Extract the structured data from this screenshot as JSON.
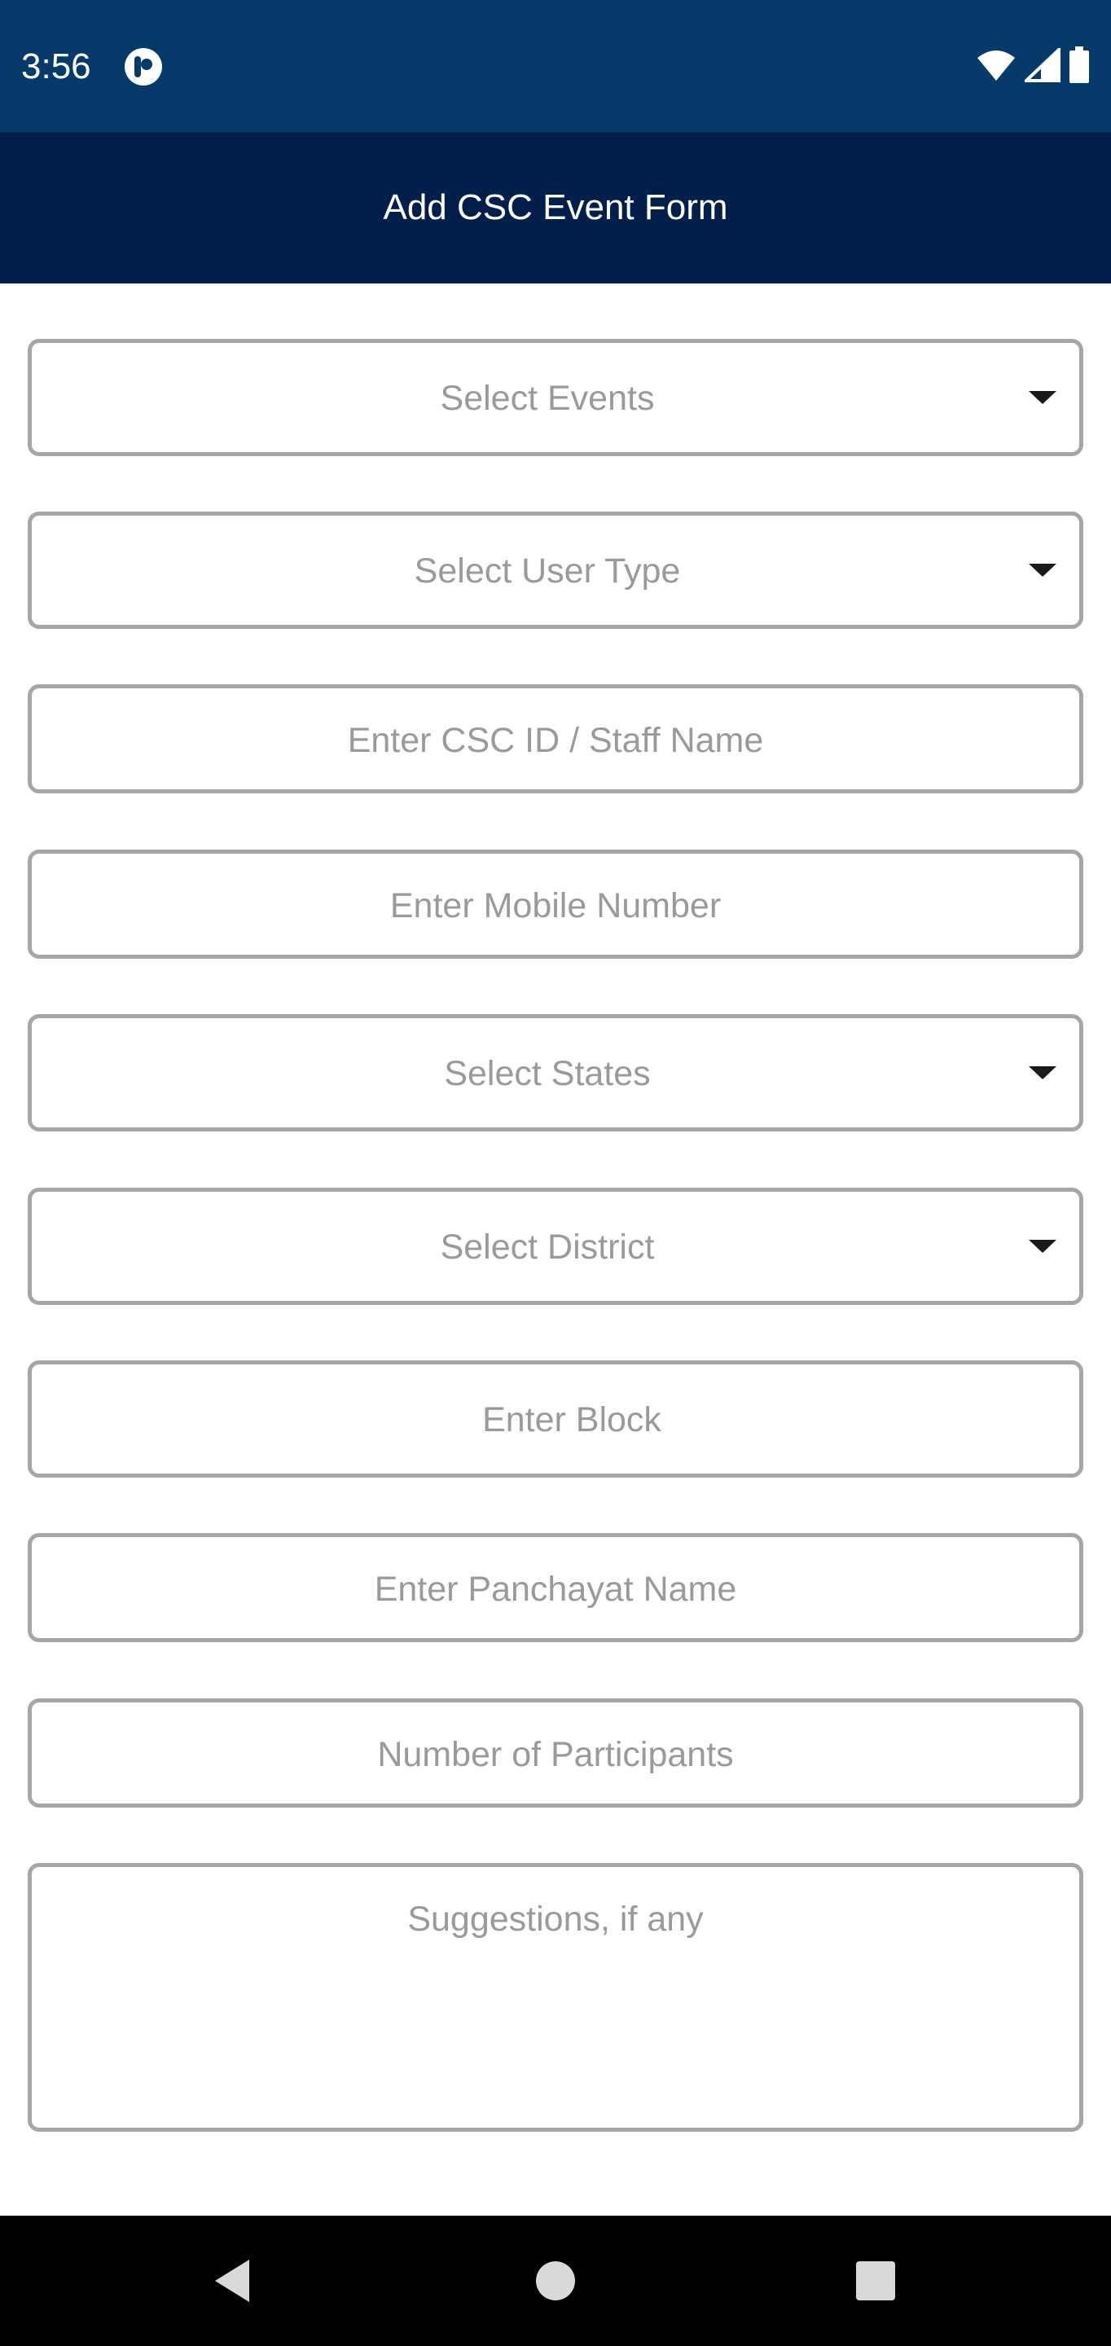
{
  "status_bar": {
    "time": "3:56",
    "app_icon": "pocket-app-icon",
    "icons": [
      "wifi-icon",
      "cell-signal-icon",
      "battery-icon"
    ],
    "background": "#053a6b"
  },
  "app_bar": {
    "title": "Add CSC Event Form",
    "background": "#021f4b"
  },
  "form": {
    "select_events": {
      "placeholder": "Select Events"
    },
    "select_user_type": {
      "placeholder": "Select User Type"
    },
    "csc_id_staff_name": {
      "placeholder": "Enter CSC ID / Staff Name"
    },
    "mobile_number": {
      "placeholder": "Enter Mobile Number"
    },
    "select_states": {
      "placeholder": "Select States"
    },
    "select_district": {
      "placeholder": "Select District"
    },
    "block": {
      "placeholder": "Enter Block"
    },
    "panchayat_name": {
      "placeholder": "Enter Panchayat Name"
    },
    "number_of_participants": {
      "placeholder": "Number of Participants"
    },
    "suggestions": {
      "placeholder": "Suggestions, if any"
    }
  },
  "nav_bar": {
    "buttons": [
      "back-icon",
      "home-icon",
      "recents-icon"
    ]
  }
}
